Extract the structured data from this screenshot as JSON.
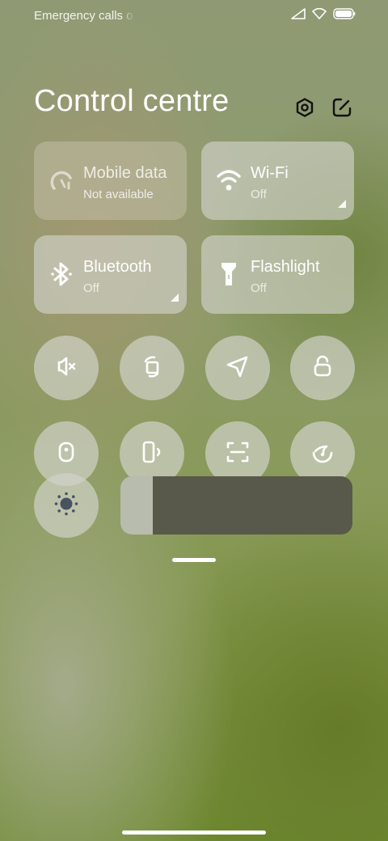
{
  "status_bar": {
    "text": "Emergency calls o",
    "icons": [
      "signal-icon",
      "wifi-icon",
      "battery-icon"
    ]
  },
  "header": {
    "title": "Control centre",
    "buttons": [
      "settings-icon",
      "edit-icon"
    ]
  },
  "tiles": {
    "mobile_data": {
      "name": "Mobile data",
      "status": "Not available",
      "icon": "mobile-data-icon"
    },
    "wifi": {
      "name": "Wi-Fi",
      "status": "Off",
      "icon": "wifi-icon"
    },
    "bluetooth": {
      "name": "Bluetooth",
      "status": "Off",
      "icon": "bluetooth-icon"
    },
    "flashlight": {
      "name": "Flashlight",
      "status": "Off",
      "icon": "flashlight-icon"
    }
  },
  "toggles": [
    "mute-icon",
    "rotation-icon",
    "location-icon",
    "lock-icon",
    "dark-mode-icon",
    "vibrate-icon",
    "scanner-icon",
    "reading-mode-icon"
  ],
  "brightness": {
    "icon": "brightness-icon",
    "level": 0.14
  },
  "colors": {
    "tile_bg": "#d0d2c8",
    "slider_track": "#58594a",
    "slider_fill": "#b7bcaf",
    "icon": "#ffffff",
    "header_icon": "#111111"
  }
}
